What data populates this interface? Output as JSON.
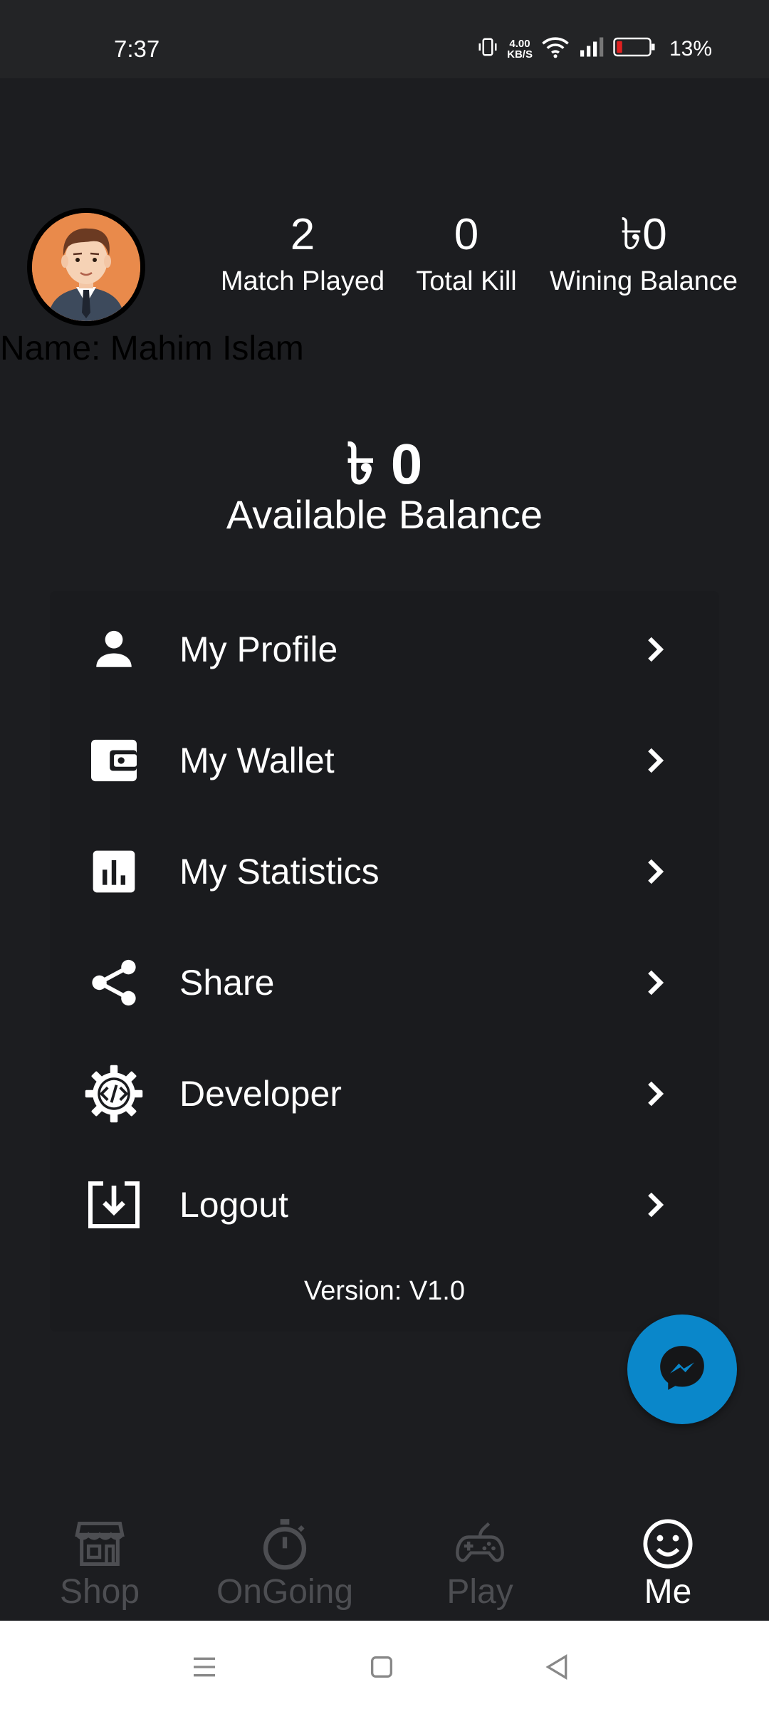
{
  "status_bar": {
    "time": "7:37",
    "net_speed_value": "4.00",
    "net_speed_unit": "KB/S",
    "battery_percent": "13%"
  },
  "profile": {
    "name": "Name: Mahim Islam",
    "stats": [
      {
        "value": "2",
        "label": "Match Played"
      },
      {
        "value": "0",
        "label": "Total Kill"
      },
      {
        "value": "৳0",
        "label": "Wining Balance"
      }
    ],
    "available_balance_amount": "৳ 0",
    "available_balance_label": "Available Balance"
  },
  "menu": {
    "items": [
      {
        "label": "My Profile",
        "icon": "person-icon"
      },
      {
        "label": "My Wallet",
        "icon": "wallet-icon"
      },
      {
        "label": "My Statistics",
        "icon": "bar-chart-icon"
      },
      {
        "label": "Share",
        "icon": "share-icon"
      },
      {
        "label": "Developer",
        "icon": "developer-gear-icon"
      },
      {
        "label": "Logout",
        "icon": "logout-icon"
      }
    ],
    "version": "Version: V1.0"
  },
  "bottom_nav": {
    "items": [
      {
        "label": "Shop",
        "icon": "shop-icon",
        "active": false
      },
      {
        "label": "OnGoing",
        "icon": "stopwatch-icon",
        "active": false
      },
      {
        "label": "Play",
        "icon": "gamepad-icon",
        "active": false
      },
      {
        "label": "Me",
        "icon": "smiley-icon",
        "active": true
      }
    ]
  },
  "colors": {
    "background": "#1c1d20",
    "card": "#1a1b1e",
    "fab": "#0a87ca",
    "avatar_bg": "#e98a4b",
    "inactive_nav": "#4d4e52"
  }
}
